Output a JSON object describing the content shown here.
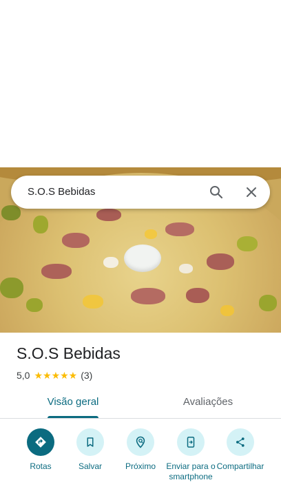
{
  "search": {
    "query": "S.O.S Bebidas"
  },
  "place": {
    "name": "S.O.S Bebidas",
    "rating": "5,0",
    "stars": "★★★★★",
    "review_count": "(3)"
  },
  "tabs": [
    {
      "label": "Visão geral",
      "active": true
    },
    {
      "label": "Avaliações",
      "active": false
    }
  ],
  "actions": [
    {
      "label": "Rotas",
      "icon": "directions-icon"
    },
    {
      "label": "Salvar",
      "icon": "bookmark-icon"
    },
    {
      "label": "Próximo",
      "icon": "nearby-icon"
    },
    {
      "label": "Enviar para o smartphone",
      "icon": "send-to-phone-icon"
    },
    {
      "label": "Compartilhar",
      "icon": "share-icon"
    }
  ],
  "colors": {
    "accent": "#0b6b80",
    "action_bg": "#d4f2f6",
    "star": "#fbbc04"
  }
}
